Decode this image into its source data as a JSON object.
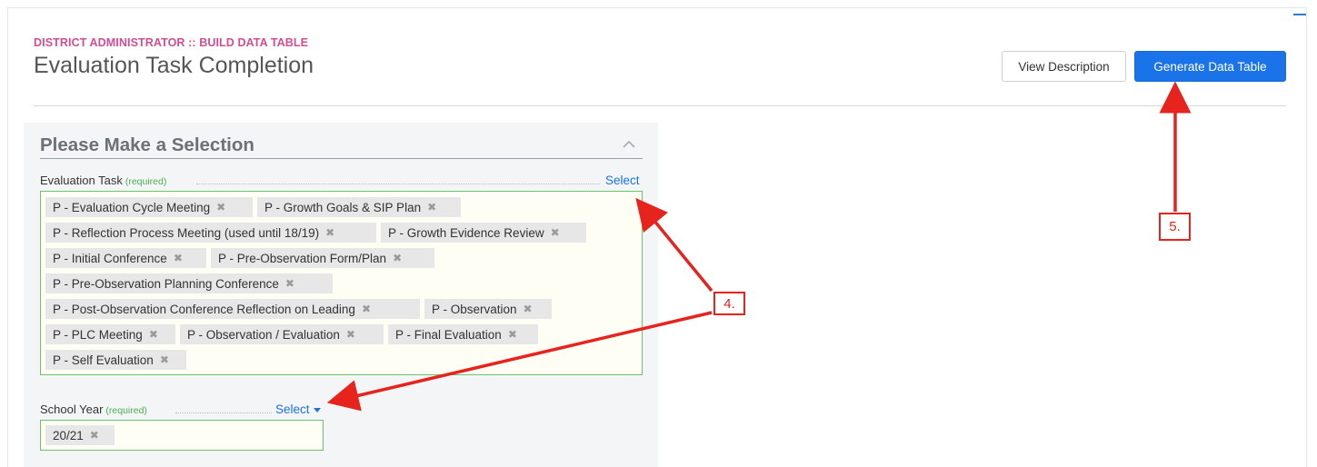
{
  "header": {
    "breadcrumb": "DISTRICT ADMINISTRATOR :: BUILD DATA TABLE",
    "title": "Evaluation Task Completion",
    "view_description_label": "View Description",
    "generate_label": "Generate Data Table"
  },
  "panel": {
    "title": "Please Make a Selection",
    "collapse_icon": "chevron-up-icon"
  },
  "evaluation_task": {
    "label": "Evaluation Task",
    "required": "(required)",
    "select_label": "Select",
    "tags": [
      "P - Evaluation Cycle Meeting",
      "P - Growth Goals & SIP Plan",
      "P - Reflection Process Meeting (used until 18/19)",
      "P - Growth Evidence Review",
      "P - Initial Conference",
      "P - Pre-Observation Form/Plan",
      "P - Pre-Observation Planning Conference",
      "P - Post-Observation Conference Reflection on Leading",
      "P - Observation",
      "P - PLC Meeting",
      "P - Observation / Evaluation",
      "P - Final Evaluation",
      "P - Self Evaluation"
    ]
  },
  "school_year": {
    "label": "School Year",
    "required": "(required)",
    "select_label": "Select",
    "tags": [
      "20/21"
    ]
  },
  "remove_glyph": "✖",
  "annotations": {
    "callout_4": "4.",
    "callout_5": "5.",
    "arrow_color": "#e6231d"
  }
}
